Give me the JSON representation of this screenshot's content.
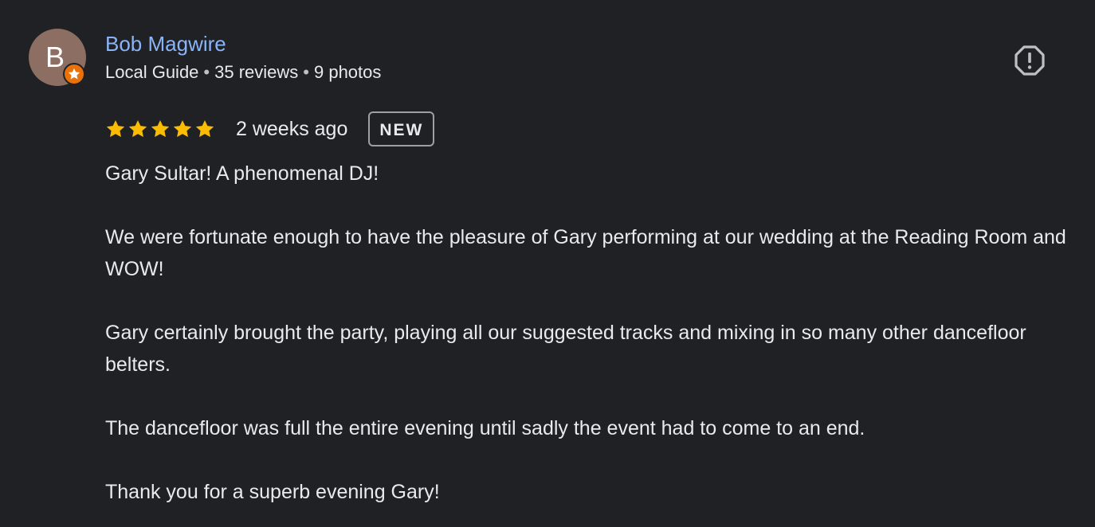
{
  "reviewer": {
    "avatar_letter": "B",
    "name": "Bob Magwire",
    "level": "Local Guide",
    "reviews": "35 reviews",
    "photos": "9 photos",
    "separator": "•"
  },
  "rating": {
    "stars": 5,
    "max_stars": 5,
    "time_ago": "2 weeks ago",
    "badge": "NEW"
  },
  "review": {
    "paragraphs": [
      "Gary Sultar! A phenomenal DJ!",
      "We were fortunate enough to have the pleasure of Gary performing at our wedding at the Reading Room and WOW!",
      "Gary certainly brought the party, playing all our suggested tracks and mixing in so many other dancefloor belters.",
      "The dancefloor was full the entire evening until sadly the event had to come to an end.",
      "Thank you for a superb evening Gary!"
    ]
  },
  "icons": {
    "report": "report-flag-icon",
    "star": "star-icon",
    "guide_badge": "local-guide-star-icon"
  },
  "colors": {
    "background": "#202124",
    "name_link": "#8ab4f8",
    "star": "#fbbc04",
    "avatar": "#8d6e63",
    "guide_badge": "#e8710a"
  }
}
